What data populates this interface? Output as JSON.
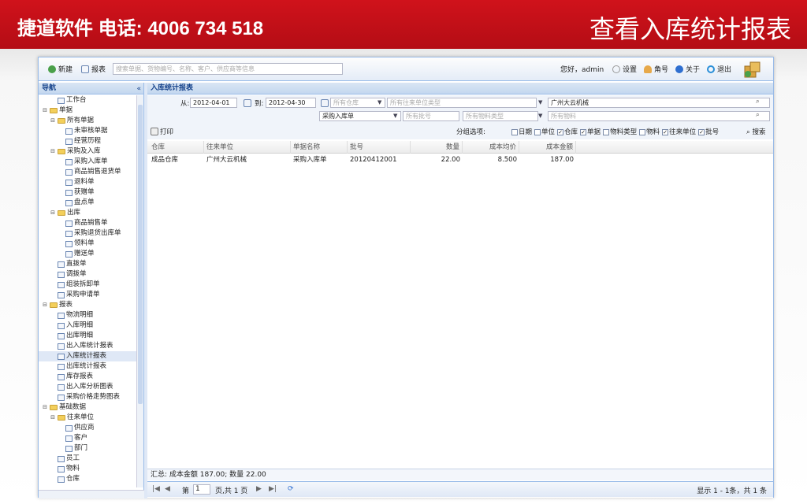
{
  "banner": {
    "left_text": "捷道软件 电话: 4006 734 518",
    "right_text": "查看入库统计报表"
  },
  "toolbar": {
    "new_label": "新建",
    "report_label": "报表",
    "search_placeholder": "搜索单据、货物编号、名称、客户、供应商等信息",
    "greeting": "您好，admin",
    "settings_label": "设置",
    "account_label": "角号",
    "about_label": "关于",
    "logout_label": "退出"
  },
  "nav": {
    "title": "导航",
    "collapse": "«",
    "items": [
      {
        "label": "工作台",
        "level": 1,
        "kind": "doc"
      },
      {
        "label": "单据",
        "level": 0,
        "kind": "folder"
      },
      {
        "label": "所有单据",
        "level": 1,
        "kind": "folder"
      },
      {
        "label": "未审核单据",
        "level": 2,
        "kind": "doc"
      },
      {
        "label": "经营历程",
        "level": 2,
        "kind": "doc"
      },
      {
        "label": "采购及入库",
        "level": 1,
        "kind": "folder"
      },
      {
        "label": "采购入库单",
        "level": 2,
        "kind": "doc"
      },
      {
        "label": "商品销售退货单",
        "level": 2,
        "kind": "doc"
      },
      {
        "label": "退料单",
        "level": 2,
        "kind": "doc"
      },
      {
        "label": "获赠单",
        "level": 2,
        "kind": "doc"
      },
      {
        "label": "盘点单",
        "level": 2,
        "kind": "doc"
      },
      {
        "label": "出库",
        "level": 1,
        "kind": "folder"
      },
      {
        "label": "商品销售单",
        "level": 2,
        "kind": "doc"
      },
      {
        "label": "采购退货出库单",
        "level": 2,
        "kind": "doc"
      },
      {
        "label": "领料单",
        "level": 2,
        "kind": "doc"
      },
      {
        "label": "赠送单",
        "level": 2,
        "kind": "doc"
      },
      {
        "label": "直拨单",
        "level": 1,
        "kind": "doc"
      },
      {
        "label": "调拨单",
        "level": 1,
        "kind": "doc"
      },
      {
        "label": "组装拆卸单",
        "level": 1,
        "kind": "doc"
      },
      {
        "label": "采购申请单",
        "level": 1,
        "kind": "doc"
      },
      {
        "label": "报表",
        "level": 0,
        "kind": "folder"
      },
      {
        "label": "物流明细",
        "level": 1,
        "kind": "doc"
      },
      {
        "label": "入库明细",
        "level": 1,
        "kind": "doc"
      },
      {
        "label": "出库明细",
        "level": 1,
        "kind": "doc"
      },
      {
        "label": "出入库统计报表",
        "level": 1,
        "kind": "doc"
      },
      {
        "label": "入库统计报表",
        "level": 1,
        "kind": "doc",
        "selected": true
      },
      {
        "label": "出库统计报表",
        "level": 1,
        "kind": "doc"
      },
      {
        "label": "库存报表",
        "level": 1,
        "kind": "doc"
      },
      {
        "label": "出入库分析图表",
        "level": 1,
        "kind": "doc"
      },
      {
        "label": "采购价格走势图表",
        "level": 1,
        "kind": "doc"
      },
      {
        "label": "基础数据",
        "level": 0,
        "kind": "folder"
      },
      {
        "label": "往来单位",
        "level": 1,
        "kind": "folder"
      },
      {
        "label": "供应商",
        "level": 2,
        "kind": "doc"
      },
      {
        "label": "客户",
        "level": 2,
        "kind": "doc"
      },
      {
        "label": "部门",
        "level": 2,
        "kind": "doc"
      },
      {
        "label": "员工",
        "level": 1,
        "kind": "doc"
      },
      {
        "label": "物料",
        "level": 1,
        "kind": "doc"
      },
      {
        "label": "仓库",
        "level": 1,
        "kind": "doc"
      }
    ]
  },
  "main": {
    "title": "入库统计报表",
    "filters": {
      "from_label": "从:",
      "from_date": "2012-04-01",
      "to_label": "到:",
      "to_date": "2012-04-30",
      "warehouse_placeholder": "所有仓库",
      "partner_type_placeholder": "所有往来单位类型",
      "partner_value": "广州大云机械",
      "doc_type_value": "采购入库单",
      "batch_placeholder": "所有批号",
      "material_type_placeholder": "所有物料类型",
      "material_placeholder": "所有物料",
      "print_label": "打印",
      "group_label": "分组选项:",
      "group_options": [
        {
          "label": "日期",
          "checked": false
        },
        {
          "label": "单位",
          "checked": false
        },
        {
          "label": "仓库",
          "checked": true
        },
        {
          "label": "单据",
          "checked": true
        },
        {
          "label": "物料类型",
          "checked": false
        },
        {
          "label": "物料",
          "checked": false
        },
        {
          "label": "往来单位",
          "checked": true
        },
        {
          "label": "批号",
          "checked": true
        }
      ],
      "search_label": "搜索"
    },
    "table": {
      "headers": [
        "仓库",
        "往来单位",
        "单据名称",
        "批号",
        "数量",
        "成本均价",
        "成本金额"
      ],
      "rows": [
        [
          "成品仓库",
          "广州大云机械",
          "采购入库单",
          "20120412001",
          "22.00",
          "8.500",
          "187.00"
        ]
      ]
    },
    "summary": "汇总: 成本金额 187.00; 数量 22.00",
    "pager": {
      "page_label": "第",
      "page_value": "1",
      "page_total": "页,共 1 页",
      "display": "显示 1 - 1条，共 1 条"
    }
  },
  "colors": {
    "banner_red": "#c8101a",
    "panel_blue": "#99bbe8",
    "header_text": "#15428b"
  }
}
